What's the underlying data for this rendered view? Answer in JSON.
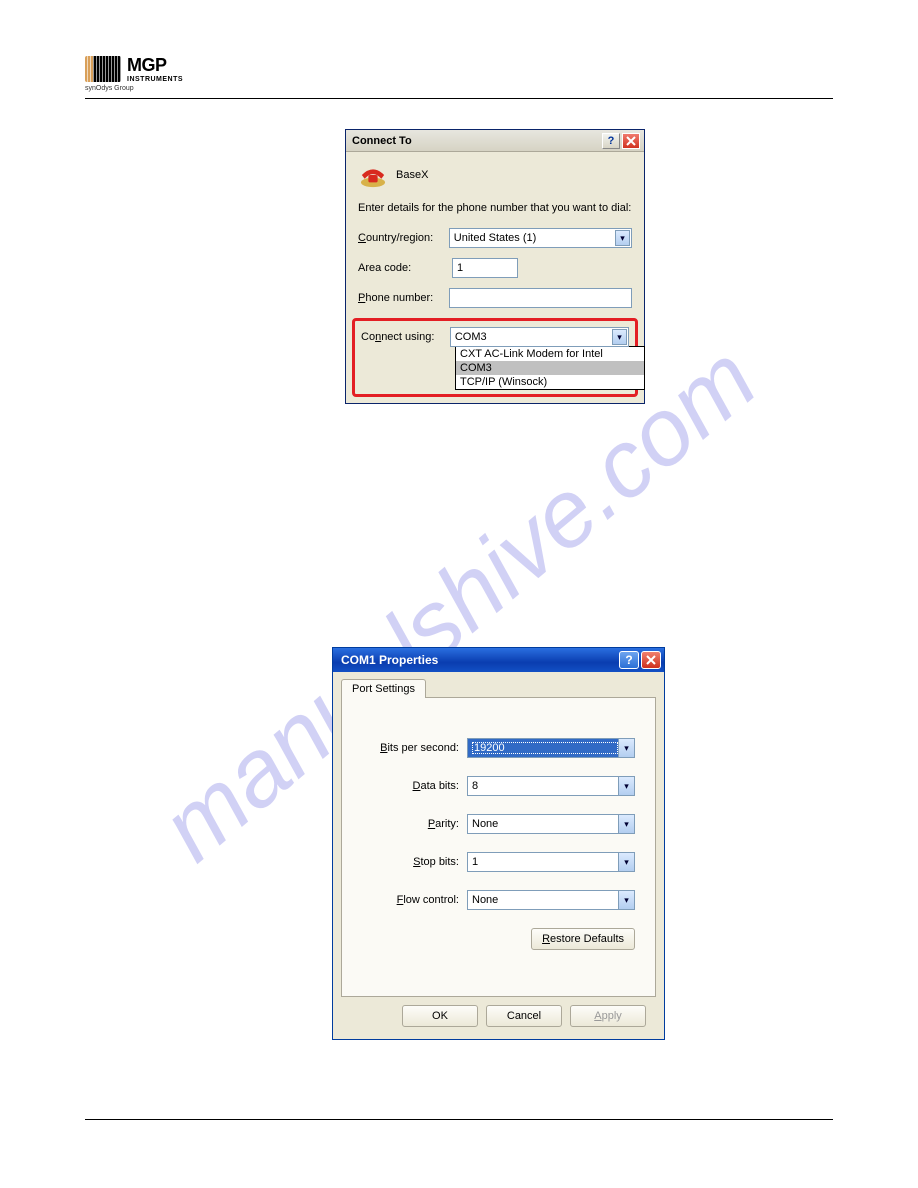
{
  "logo": {
    "brand": "MGP",
    "sub": "INSTRUMENTS",
    "group": "synOdys Group"
  },
  "watermark": "manualshive.com",
  "connect_to": {
    "title": "Connect To",
    "icon_name": "BaseX",
    "instruction": "Enter details for the phone number that you want to dial:",
    "country_label": "Country/region:",
    "country_value": "United States (1)",
    "area_label": "Area code:",
    "area_value": "1",
    "phone_label": "Phone number:",
    "phone_value": "",
    "connect_label": "Connect using:",
    "connect_value": "COM3",
    "options": [
      "CXT AC-Link Modem for Intel",
      "COM3",
      "TCP/IP (Winsock)"
    ]
  },
  "com_props": {
    "title": "COM1 Properties",
    "tab_label": "Port Settings",
    "rows": {
      "bits_label": "Bits per second:",
      "bits_value": "19200",
      "databits_label": "Data bits:",
      "databits_value": "8",
      "parity_label": "Parity:",
      "parity_value": "None",
      "stopbits_label": "Stop bits:",
      "stopbits_value": "1",
      "flow_label": "Flow control:",
      "flow_value": "None"
    },
    "restore_label": "Restore Defaults",
    "ok_label": "OK",
    "cancel_label": "Cancel",
    "apply_label": "Apply"
  }
}
